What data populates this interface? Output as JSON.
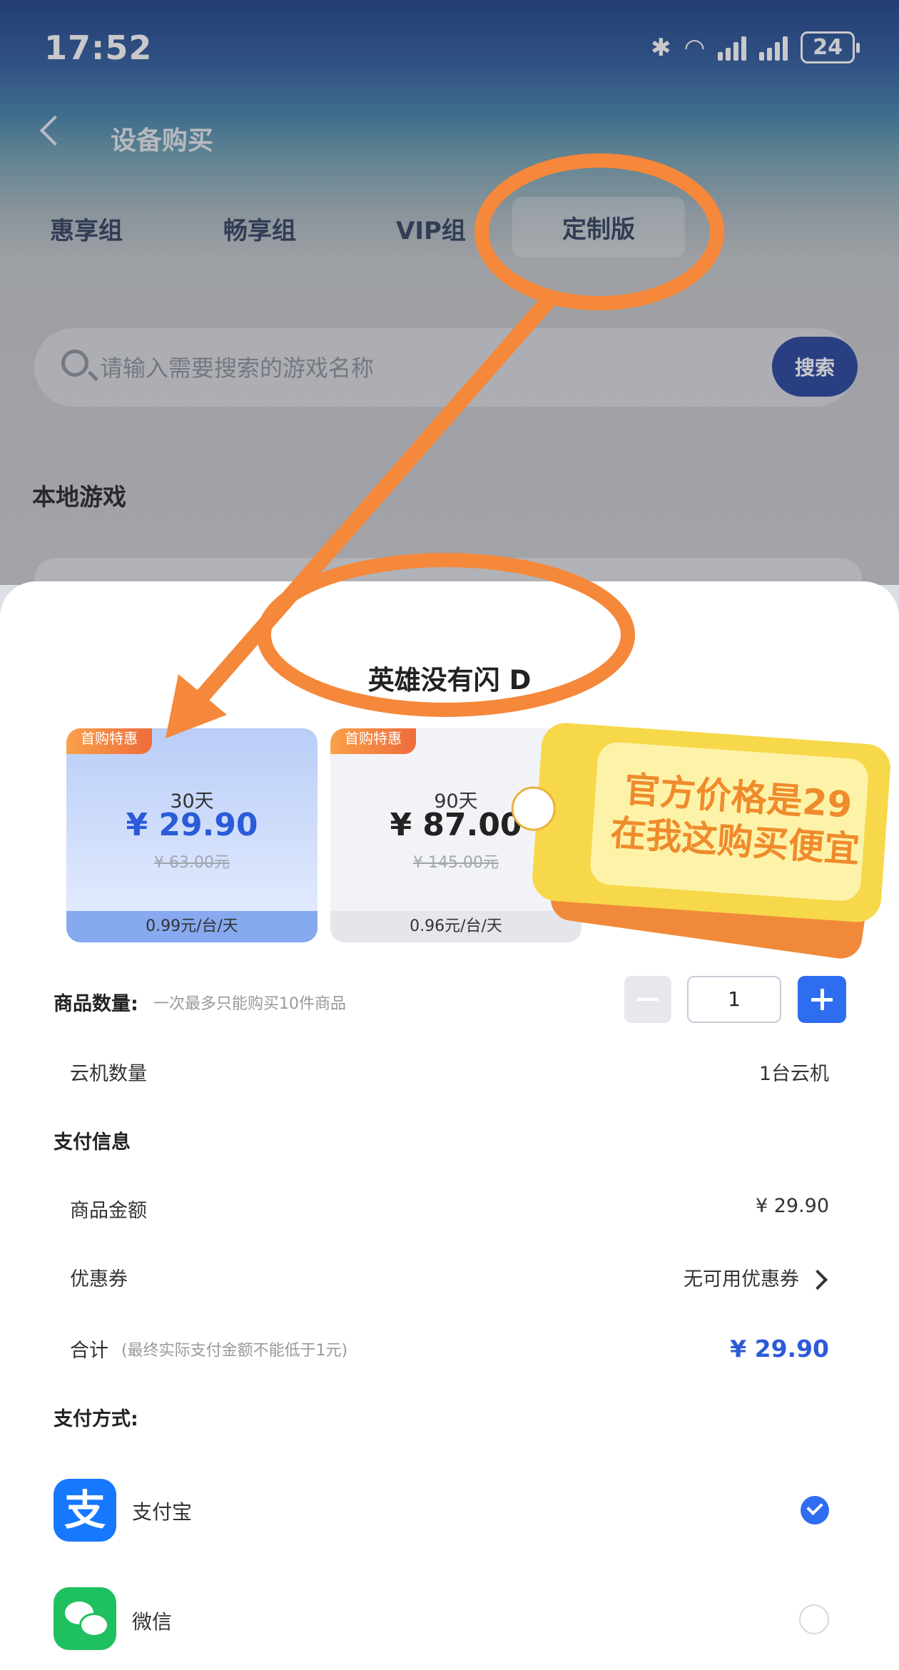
{
  "status_bar": {
    "time": "17:52",
    "battery": "24"
  },
  "header": {
    "title": "设备购买"
  },
  "tabs": [
    "惠享组",
    "畅享组",
    "VIP组",
    "定制版"
  ],
  "search": {
    "placeholder": "请输入需要搜索的游戏名称",
    "button": "搜索"
  },
  "local_section": {
    "title": "本地游戏"
  },
  "sheet": {
    "game_name": "英雄没有闪 D",
    "plans": [
      {
        "badge": "首购特惠",
        "days": "30天",
        "price": "¥ 29.90",
        "original": "¥ 63.00元",
        "daily": "0.99元/台/天",
        "selected": true
      },
      {
        "badge": "首购特惠",
        "days": "90天",
        "price": "¥ 87.00",
        "original": "¥ 145.00元",
        "daily": "0.96元/台/天",
        "selected": false
      }
    ],
    "quantity": {
      "label": "商品数量:",
      "hint": "一次最多只能购买10件商品",
      "value": "1"
    },
    "cloud_count": {
      "label": "云机数量",
      "value": "1台云机"
    },
    "payment_info": {
      "title": "支付信息",
      "amount_label": "商品金额",
      "amount_value": "¥ 29.90",
      "coupon_label": "优惠券",
      "coupon_value": "无可用优惠券",
      "total_label": "合计",
      "total_note": "(最终实际支付金额不能低于1元)",
      "total_value": "¥ 29.90"
    },
    "payment_method": {
      "title": "支付方式:",
      "options": [
        {
          "name": "支付宝",
          "selected": true
        },
        {
          "name": "微信",
          "selected": false
        }
      ]
    }
  },
  "annotation": {
    "tag_line1": "官方价格是29",
    "tag_line2": "在我这购买便宜"
  },
  "colors": {
    "accent": "#2b5bd7",
    "annotation_orange": "#f5883a",
    "tag_yellow": "#f7d84a"
  }
}
